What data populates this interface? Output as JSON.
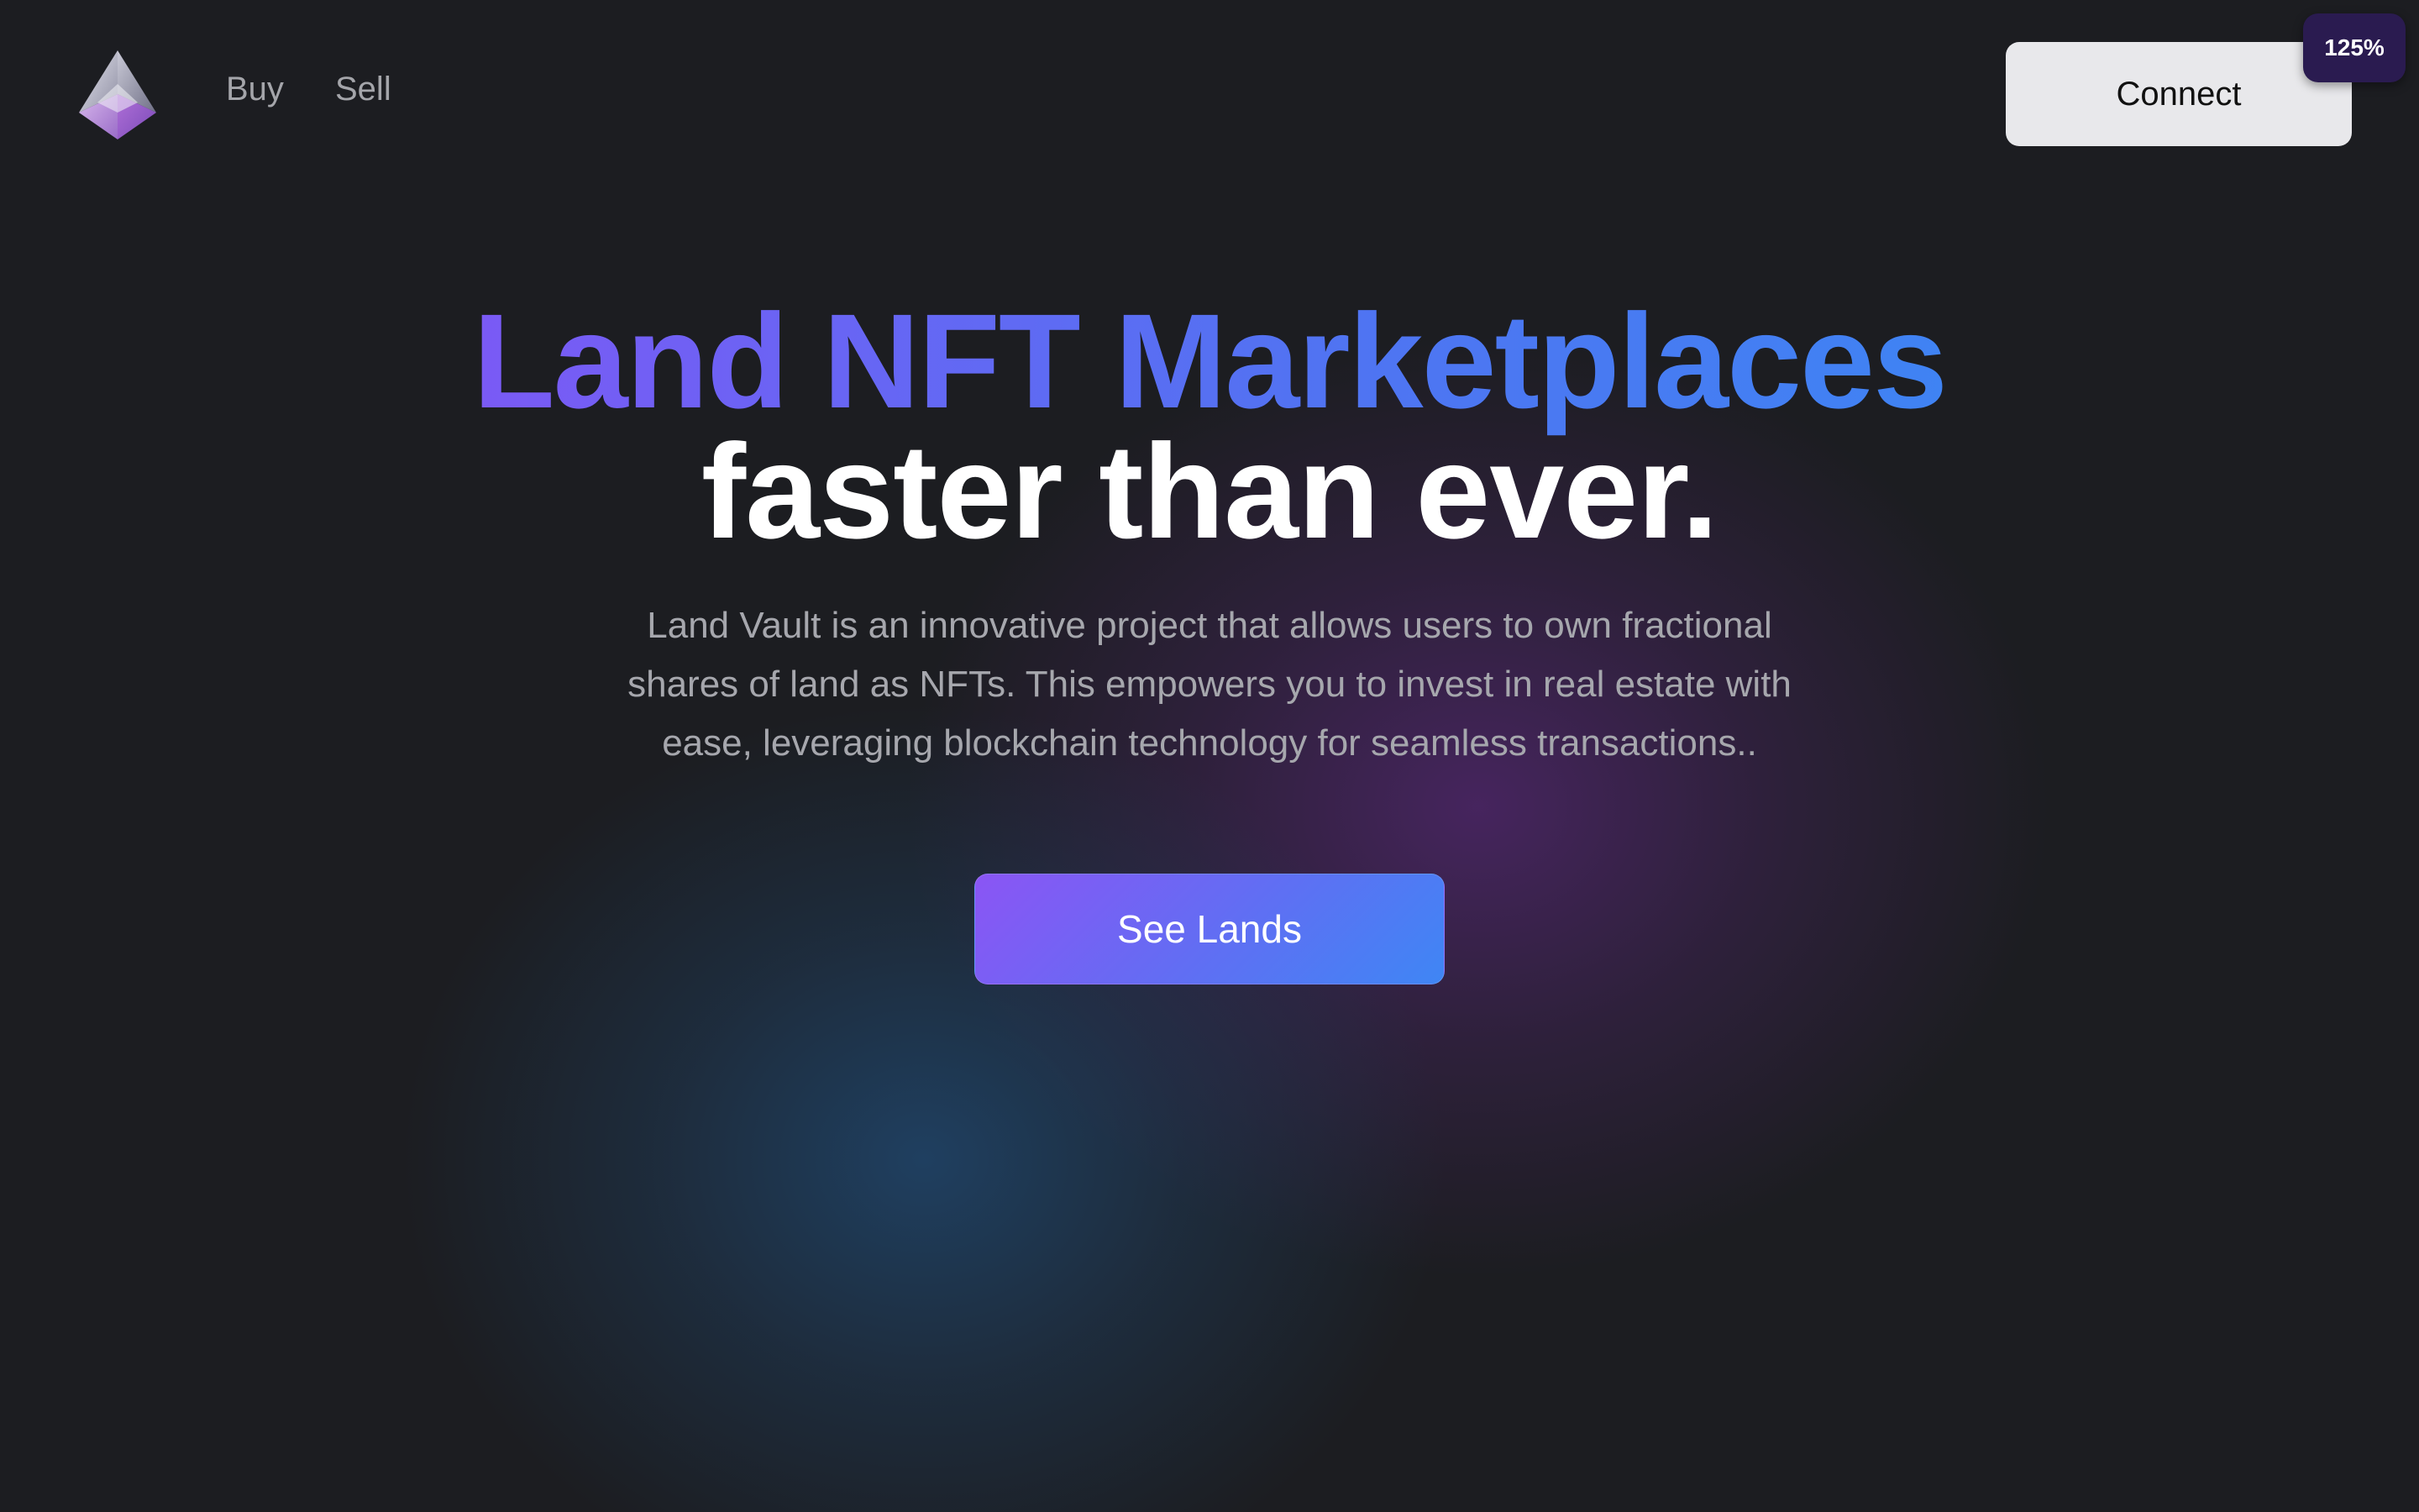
{
  "nav": {
    "logo_icon": "ethereum-diamond-icon",
    "links": [
      {
        "label": "Buy"
      },
      {
        "label": "Sell"
      }
    ],
    "connect_label": "Connect"
  },
  "zoom_badge": "125%",
  "hero": {
    "title_line1": "Land NFT Marketplaces",
    "title_line2": "faster than ever.",
    "description": "Land Vault is an innovative project that allows users to own fractional shares of land as NFTs. This empowers you to invest in real estate with ease, leveraging blockchain technology for seamless transactions..",
    "cta_label": "See Lands"
  },
  "colors": {
    "background": "#1c1d21",
    "accent_purple": "#7a5af5",
    "accent_blue": "#3f83f3",
    "connect_bg": "#e8e8eb"
  }
}
